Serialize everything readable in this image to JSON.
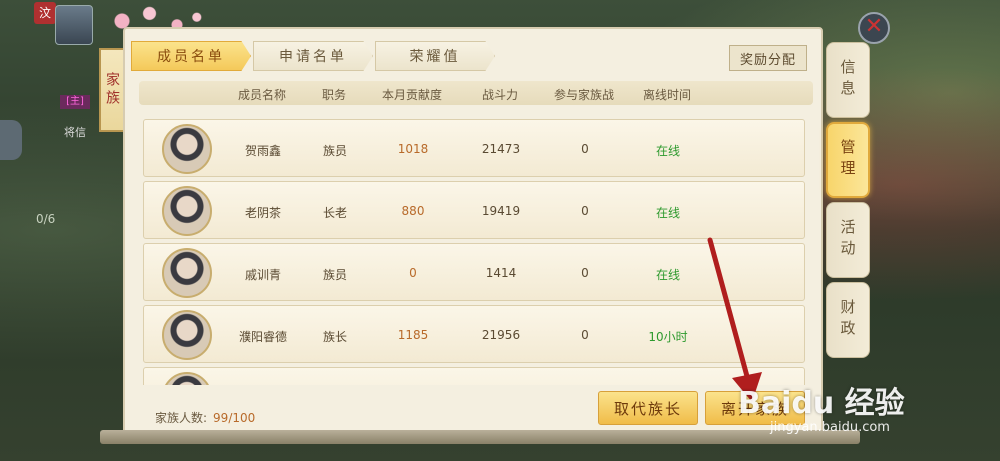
{
  "hud": {
    "badge": "汶",
    "tag": "[主]",
    "text": "将信",
    "count": "0/6"
  },
  "close_glyph": "✕",
  "banner": "家族",
  "tabs": [
    {
      "label": "成员名单",
      "active": true
    },
    {
      "label": "申请名单",
      "active": false
    },
    {
      "label": "荣耀值",
      "active": false
    }
  ],
  "reward_button": "奖励分配",
  "columns": [
    "成员名称",
    "职务",
    "本月贡献度",
    "战斗力",
    "参与家族战",
    "离线时间"
  ],
  "members": [
    {
      "name": "贺雨鑫",
      "role": "族员",
      "contribution": "1018",
      "power": "21473",
      "battles": "0",
      "status": "在线"
    },
    {
      "name": "老阴茶",
      "role": "长老",
      "contribution": "880",
      "power": "19419",
      "battles": "0",
      "status": "在线"
    },
    {
      "name": "戚训青",
      "role": "族员",
      "contribution": "0",
      "power": "1414",
      "battles": "0",
      "status": "在线"
    },
    {
      "name": "濮阳睿德",
      "role": "族长",
      "contribution": "1185",
      "power": "21956",
      "battles": "0",
      "status": "10小时"
    }
  ],
  "footer": {
    "label": "家族人数:",
    "count": "99/100"
  },
  "buttons": {
    "replace_leader": "取代族长",
    "leave_family": "离开家族"
  },
  "side_tabs": [
    {
      "label": "信息",
      "active": false
    },
    {
      "label": "管理",
      "active": true
    },
    {
      "label": "活动",
      "active": false
    },
    {
      "label": "财政",
      "active": false
    }
  ],
  "watermark": {
    "brand": "Baidu 经验",
    "url": "jingyan.baidu.com"
  },
  "colors": {
    "accent": "#f4c95a",
    "online": "#2e9a2e",
    "contribution": "#b86a2a",
    "annotation_arrow": "#b01e1e"
  }
}
